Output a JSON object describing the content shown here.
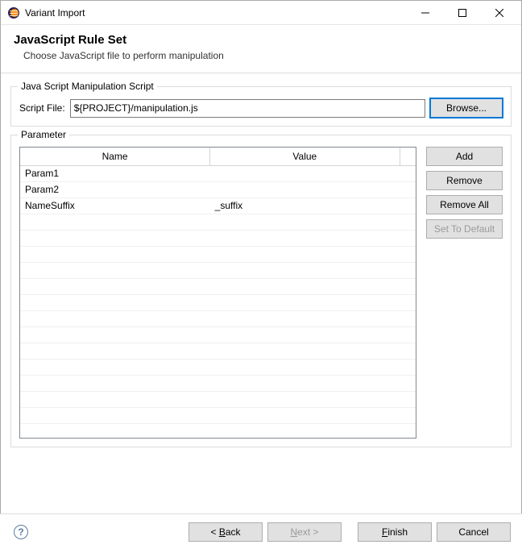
{
  "window": {
    "title": "Variant Import"
  },
  "banner": {
    "heading": "JavaScript Rule Set",
    "subheading": "Choose JavaScript file to perform manipulation"
  },
  "script_group": {
    "legend": "Java Script Manipulation Script",
    "label": "Script File:",
    "value": "${PROJECT}/manipulation.js",
    "browse": "Browse..."
  },
  "param_group": {
    "legend": "Parameter",
    "columns": {
      "name": "Name",
      "value": "Value"
    },
    "rows": [
      {
        "name": "Param1",
        "value": ""
      },
      {
        "name": "Param2",
        "value": ""
      },
      {
        "name": "NameSuffix",
        "value": "_suffix"
      }
    ],
    "buttons": {
      "add": "Add",
      "remove": "Remove",
      "remove_all": "Remove All",
      "set_default": "Set To Default"
    }
  },
  "footer": {
    "back": "Back",
    "next": "Next",
    "finish": "Finish",
    "cancel": "Cancel"
  }
}
